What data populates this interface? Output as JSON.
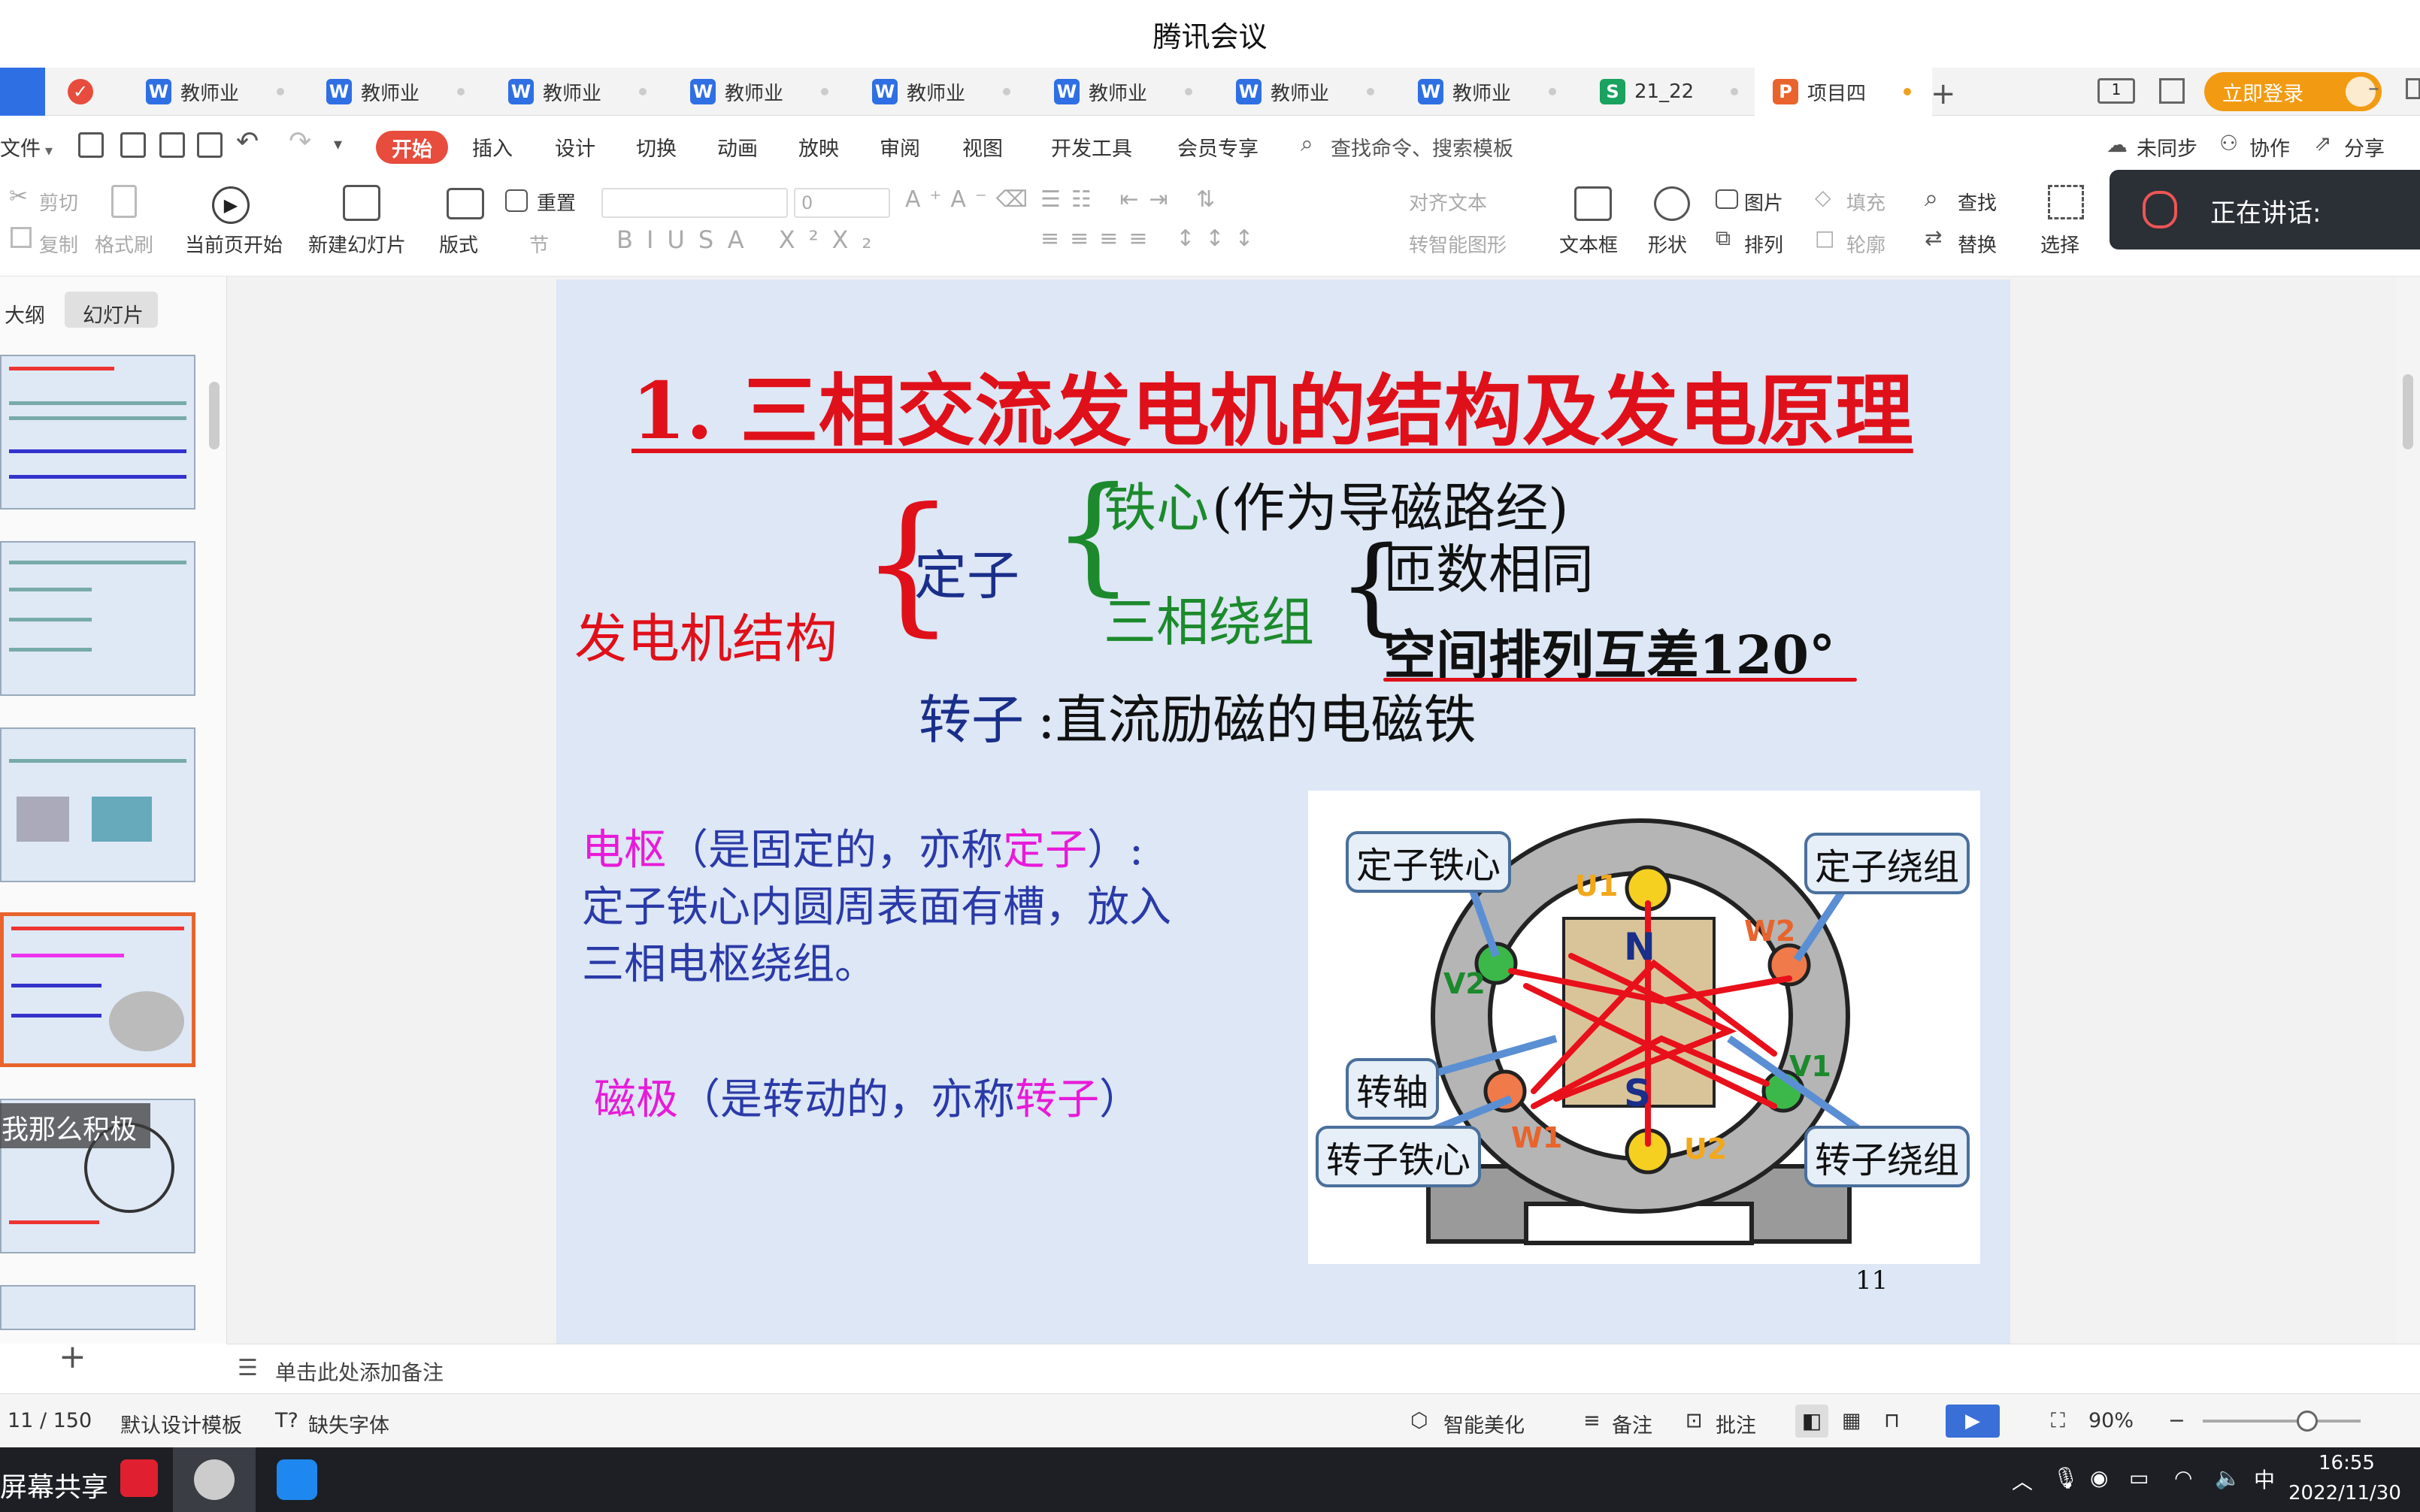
{
  "window": {
    "title": "腾讯会议"
  },
  "tabs": [
    {
      "icon": "W",
      "label": "教师业",
      "color": "#2f6fe4"
    },
    {
      "icon": "W",
      "label": "教师业",
      "color": "#2f6fe4"
    },
    {
      "icon": "W",
      "label": "教师业",
      "color": "#2f6fe4"
    },
    {
      "icon": "W",
      "label": "教师业",
      "color": "#2f6fe4"
    },
    {
      "icon": "W",
      "label": "教师业",
      "color": "#2f6fe4"
    },
    {
      "icon": "W",
      "label": "教师业",
      "color": "#2f6fe4"
    },
    {
      "icon": "W",
      "label": "教师业",
      "color": "#2f6fe4"
    },
    {
      "icon": "W",
      "label": "教师业",
      "color": "#2f6fe4"
    },
    {
      "icon": "S",
      "label": "21_22",
      "color": "#1aa260"
    },
    {
      "icon": "P",
      "label": "项目四",
      "color": "#e8642c"
    }
  ],
  "login_button": "立即登录",
  "menu": {
    "file": "文件",
    "start": "开始",
    "items": [
      "插入",
      "设计",
      "切换",
      "动画",
      "放映",
      "审阅",
      "视图",
      "开发工具",
      "会员专享"
    ],
    "search": "查找命令、搜索模板",
    "sync": "未同步",
    "collab": "协作",
    "share": "分享"
  },
  "ribbon": {
    "cut": "剪切",
    "copy": "复制",
    "format_painter": "格式刷",
    "play_current": "当前页开始",
    "new_slide": "新建幻灯片",
    "layout": "版式",
    "section": "节",
    "reset": "重置",
    "font_size": "0",
    "align_text": "对齐文本",
    "smart_shape": "转智能图形",
    "textbox": "文本框",
    "shape": "形状",
    "picture": "图片",
    "arrange": "排列",
    "fill": "填充",
    "outline": "轮廓",
    "find": "查找",
    "replace": "替换",
    "select": "选择"
  },
  "speaking": "正在讲话:",
  "side_panel": {
    "outline_tab": "大纲",
    "slides_tab": "幻灯片",
    "overlay_text": "我那么积极"
  },
  "slide": {
    "title": "1. 三相交流发电机的结构及发电原理",
    "structure_label": "发电机结构",
    "stator": "定子",
    "iron_core": "铁心",
    "iron_core_note": "(作为导磁路经)",
    "three_phase_winding": "三相绕组",
    "same_turns": "匝数相同",
    "spatial_diff": "空间排列互差120°",
    "rotor": "转子",
    "rotor_note": ":直流励磁的电磁铁",
    "armature_word": "电枢",
    "armature_p1": "（是固定的，亦称",
    "armature_p2": "定子",
    "armature_p3": "）:",
    "armature_line2": "定子铁心内圆周表面有槽，放入",
    "armature_line3": "三相电枢绕组。",
    "pole_word": "磁极",
    "pole_p1": "（是转动的，亦称",
    "pole_p2": "转子",
    "pole_p3": "）",
    "page_number": "11",
    "figure_labels": {
      "stator_core": "定子铁心",
      "stator_winding": "定子绕组",
      "shaft": "转轴",
      "rotor_core": "转子铁心",
      "rotor_winding": "转子绕组",
      "u1": "U1",
      "u2": "U2",
      "v1": "V1",
      "v2": "V2",
      "w1": "W1",
      "w2": "W2",
      "n": "N",
      "s": "S"
    },
    "colors": {
      "title": "#e0101a",
      "magenta": "#e81ad9",
      "green": "#1c8a2c",
      "navy": "#1a2e8a",
      "blue_text": "#2a3aa8"
    }
  },
  "notes_placeholder": "单击此处添加备注",
  "status": {
    "page": "11 / 150",
    "template": "默认设计模板",
    "missing_font": "缺失字体",
    "beautify": "智能美化",
    "notes": "备注",
    "comment": "批注",
    "zoom": "90%",
    "zoom_fraction": 0.66
  },
  "taskbar": {
    "screen_share": "屏幕共享",
    "ime": "中",
    "time": "16:55",
    "date": "2022/11/30"
  }
}
